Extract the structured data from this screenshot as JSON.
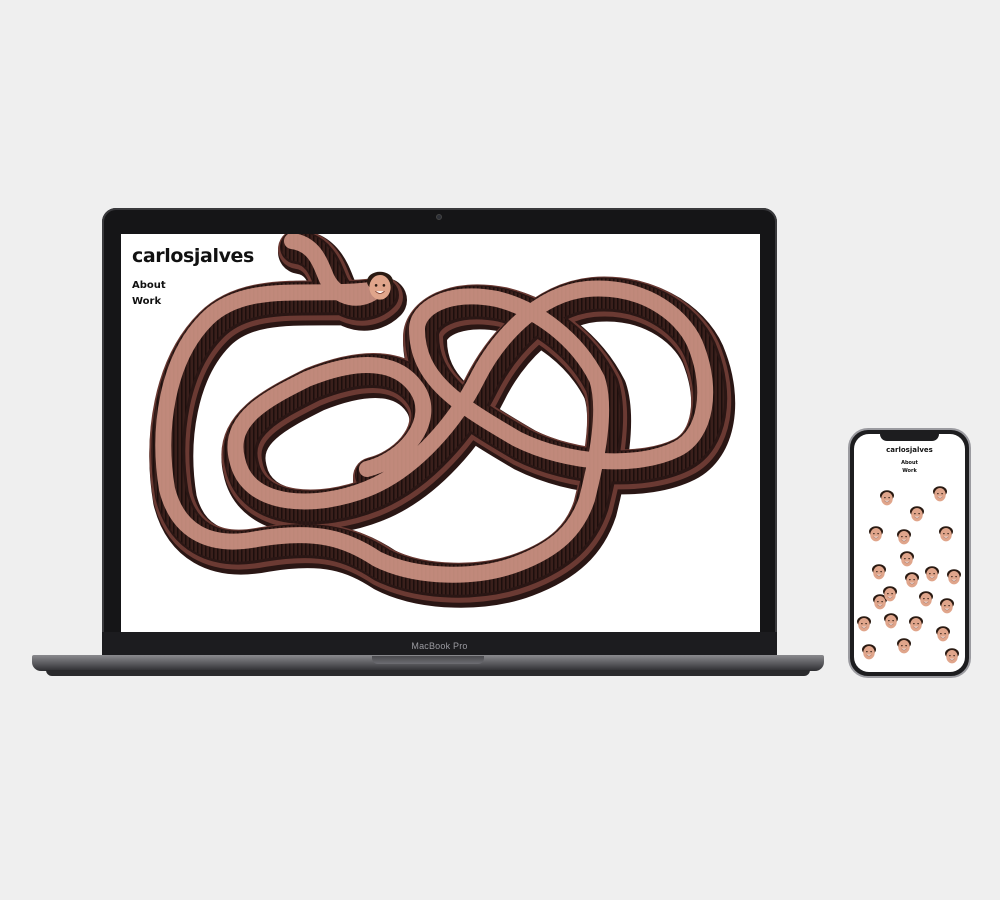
{
  "site": {
    "title": "carlosjalves",
    "nav": [
      "About",
      "Work"
    ]
  },
  "laptop": {
    "model_label": "MacBook Pro"
  },
  "mobile": {
    "title": "carlosjalves",
    "nav": [
      "About",
      "Work"
    ],
    "face_count": 22
  },
  "colors": {
    "background": "#efefef",
    "worm_dark": "#2a1614",
    "worm_mid": "#6b3a33",
    "worm_light": "#d99c8c",
    "skin": "#e0a58b",
    "hair": "#2a1a12"
  },
  "icons": {
    "face": "smiling-face-portrait"
  }
}
